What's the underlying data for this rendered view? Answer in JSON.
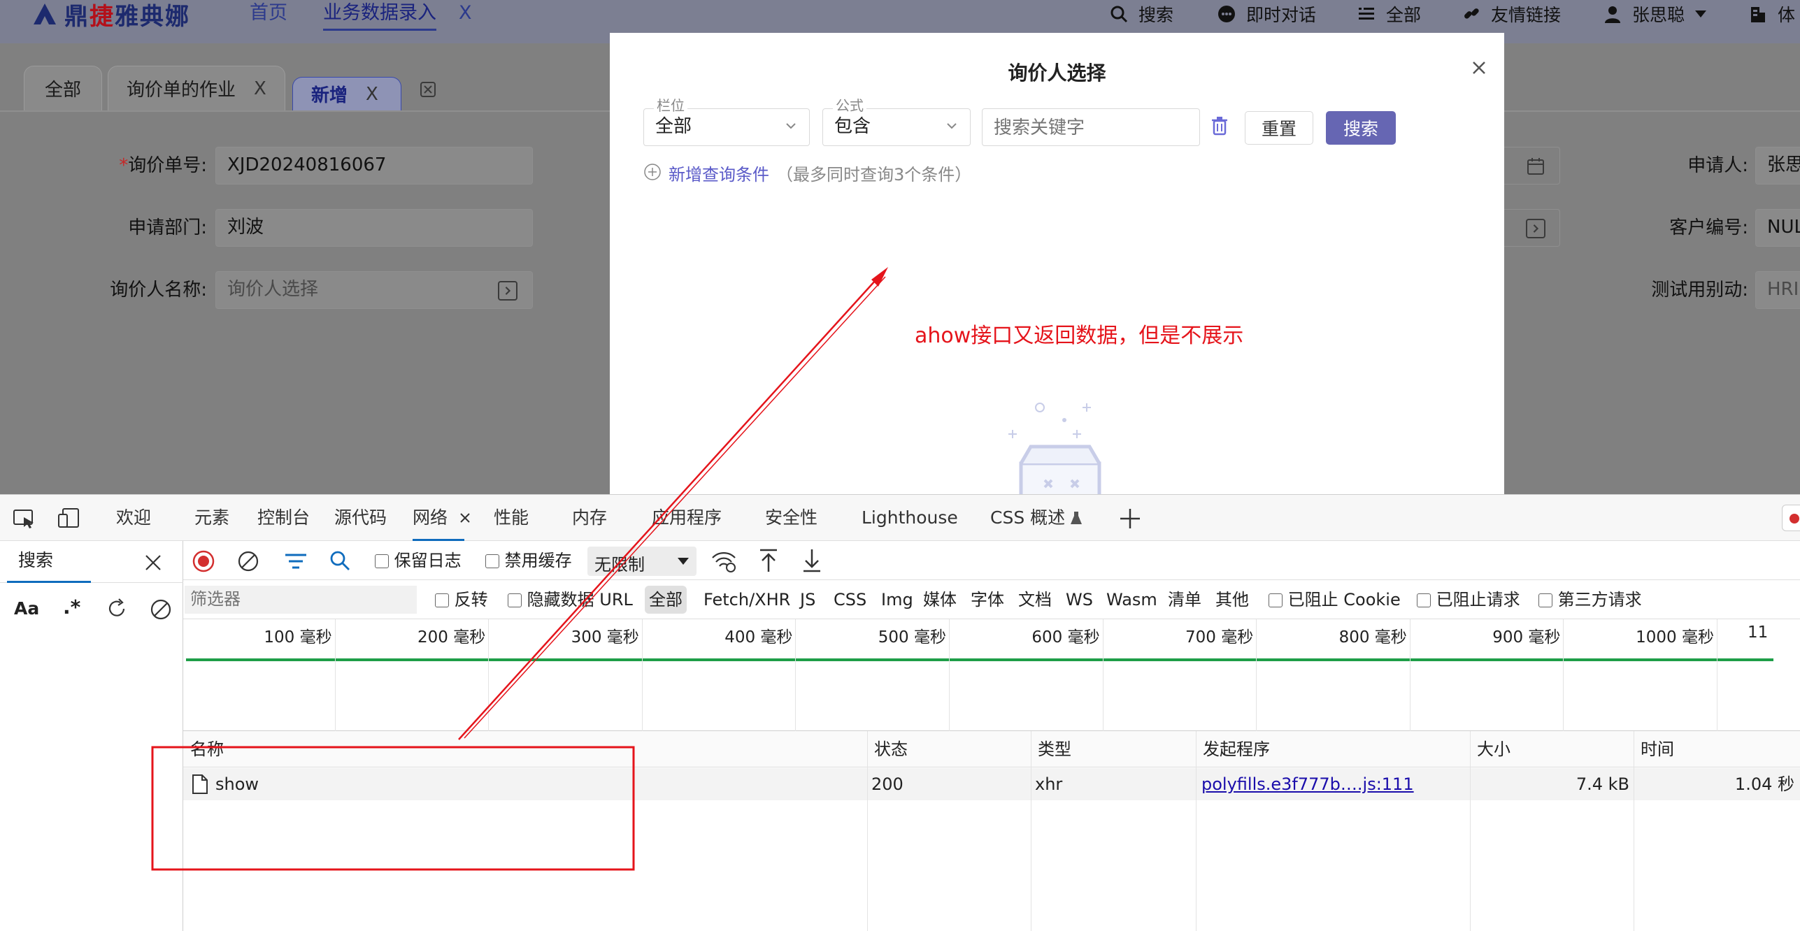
{
  "app": {
    "brand": {
      "part1": "鼎",
      "part2": "捷",
      "part3": "雅典娜"
    },
    "nav": {
      "home": "首页",
      "data_entry": "业务数据录入",
      "data_entry_close": "X"
    },
    "right_nav": {
      "search": "搜索",
      "chat": "即时对话",
      "all": "全部",
      "links": "友情链接",
      "user": "张思聪",
      "more": "体"
    },
    "tabs": [
      {
        "label": "全部"
      },
      {
        "label": "询价单的作业",
        "close": "X"
      },
      {
        "label": "新增",
        "close": "X"
      }
    ],
    "form": {
      "inquiry_no_req": "*",
      "inquiry_no_label": "询价单号:",
      "inquiry_no_value": "XJD20240816067",
      "dept_label": "申请部门:",
      "dept_value": "刘波",
      "inquirer_label": "询价人名称:",
      "inquirer_placeholder": "询价人选择",
      "applicant_label": "申请人:",
      "applicant_value": "张思",
      "customer_no_label": "客户编号:",
      "customer_no_value": "NUL",
      "test_label": "测试用别动:",
      "test_value": "HRI"
    }
  },
  "modal": {
    "title": "询价人选择",
    "field_label": "栏位",
    "field_value": "全部",
    "formula_label": "公式",
    "formula_value": "包含",
    "keyword_placeholder": "搜索关键字",
    "reset": "重置",
    "search": "搜索",
    "add_condition": "新增查询条件",
    "add_condition_hint": "（最多同时查询3个条件）"
  },
  "annotation": {
    "text": "ahow接口又返回数据，但是不展示",
    "color": "#e5141b"
  },
  "devtools": {
    "tabs": [
      "欢迎",
      "元素",
      "控制台",
      "源代码",
      "网络",
      "性能",
      "内存",
      "应用程序",
      "安全性",
      "Lighthouse",
      "CSS 概述"
    ],
    "active_tab": "网络",
    "search_tab": "搜索",
    "search_aa": "Aa",
    "search_regex": ".*",
    "toolbar": {
      "preserve_log": "保留日志",
      "disable_cache": "禁用缓存",
      "throttle": "无限制"
    },
    "filter": {
      "placeholder": "筛选器",
      "invert": "反转",
      "hide_data_urls": "隐藏数据 URL",
      "types": [
        "全部",
        "Fetch/XHR",
        "JS",
        "CSS",
        "Img",
        "媒体",
        "字体",
        "文档",
        "WS",
        "Wasm",
        "清单",
        "其他"
      ],
      "blocked_cookies": "已阻止 Cookie",
      "blocked_requests": "已阻止请求",
      "third_party": "第三方请求"
    },
    "timeline_ticks": [
      "100 毫秒",
      "200 毫秒",
      "300 毫秒",
      "400 毫秒",
      "500 毫秒",
      "600 毫秒",
      "700 毫秒",
      "800 毫秒",
      "900 毫秒",
      "1000 毫秒",
      "11"
    ],
    "columns": [
      "名称",
      "状态",
      "类型",
      "发起程序",
      "大小",
      "时间"
    ],
    "rows": [
      {
        "name": "show",
        "status": "200",
        "type": "xhr",
        "initiator": "polyfills.e3f777b….js:111",
        "size": "7.4 kB",
        "time": "1.04 秒"
      }
    ]
  }
}
